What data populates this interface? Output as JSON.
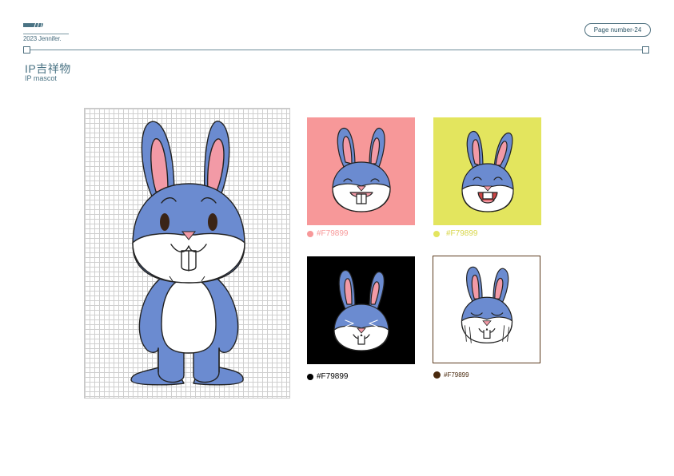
{
  "header": {
    "brand_year": "2023 Jennifer.",
    "page_label": "Page number-24"
  },
  "section": {
    "title_zh": "IP吉祥物",
    "title_en": "IP mascot"
  },
  "colors": {
    "brand_teal": "#2c5566",
    "rule": "#6d8c99",
    "bunny_blue": "#6b8bd0",
    "inner_ear_pink": "#f29aa6",
    "outline": "#222222"
  },
  "swatches": [
    {
      "background": "#F79899",
      "dot_color": "#F79899",
      "label": "#F79899",
      "label_color": "#F79899",
      "expression": "laughing"
    },
    {
      "background": "#E3E55E",
      "dot_color": "#E3E55E",
      "label": "#F79899",
      "label_color": "#D8D64A",
      "expression": "excited"
    },
    {
      "background": "#000000",
      "dot_color": "#000000",
      "label": "#F79899",
      "label_color": "#000000",
      "expression": "squinting"
    },
    {
      "background": "#FFFFFF",
      "border": "#5c3b1e",
      "dot_color": "#4a2a0e",
      "label": "#F79899",
      "label_color": "#4a2a0e",
      "expression": "crying"
    }
  ]
}
